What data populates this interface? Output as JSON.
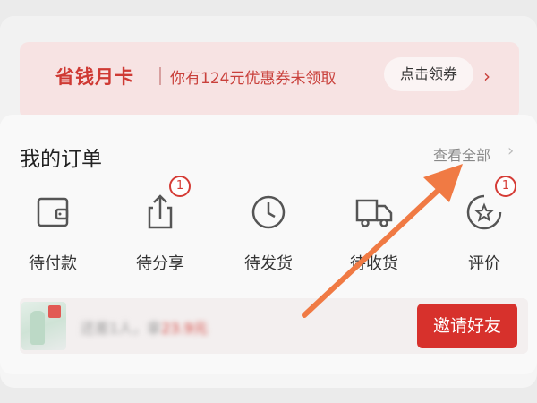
{
  "promo": {
    "title": "省钱月卡",
    "text": "你有124元优惠券未领取",
    "button": "点击领券",
    "chevron": "›"
  },
  "orders": {
    "title": "我的订单",
    "view_all": "查看全部",
    "view_all_chevron": "›",
    "items": [
      {
        "label": "待付款",
        "icon": "wallet-icon"
      },
      {
        "label": "待分享",
        "icon": "share-icon",
        "badge": "1"
      },
      {
        "label": "待发货",
        "icon": "clock-icon"
      },
      {
        "label": "待收货",
        "icon": "truck-icon"
      },
      {
        "label": "评价",
        "icon": "star-comment-icon",
        "badge": "1"
      }
    ]
  },
  "invite": {
    "blurred_text": "还差1人，拿",
    "blurred_amount": "23.9元",
    "button": "邀请好友"
  },
  "colors": {
    "accent": "#d7312c",
    "promo_bg": "#f7e3e3",
    "annotation_arrow": "#f07a44"
  }
}
